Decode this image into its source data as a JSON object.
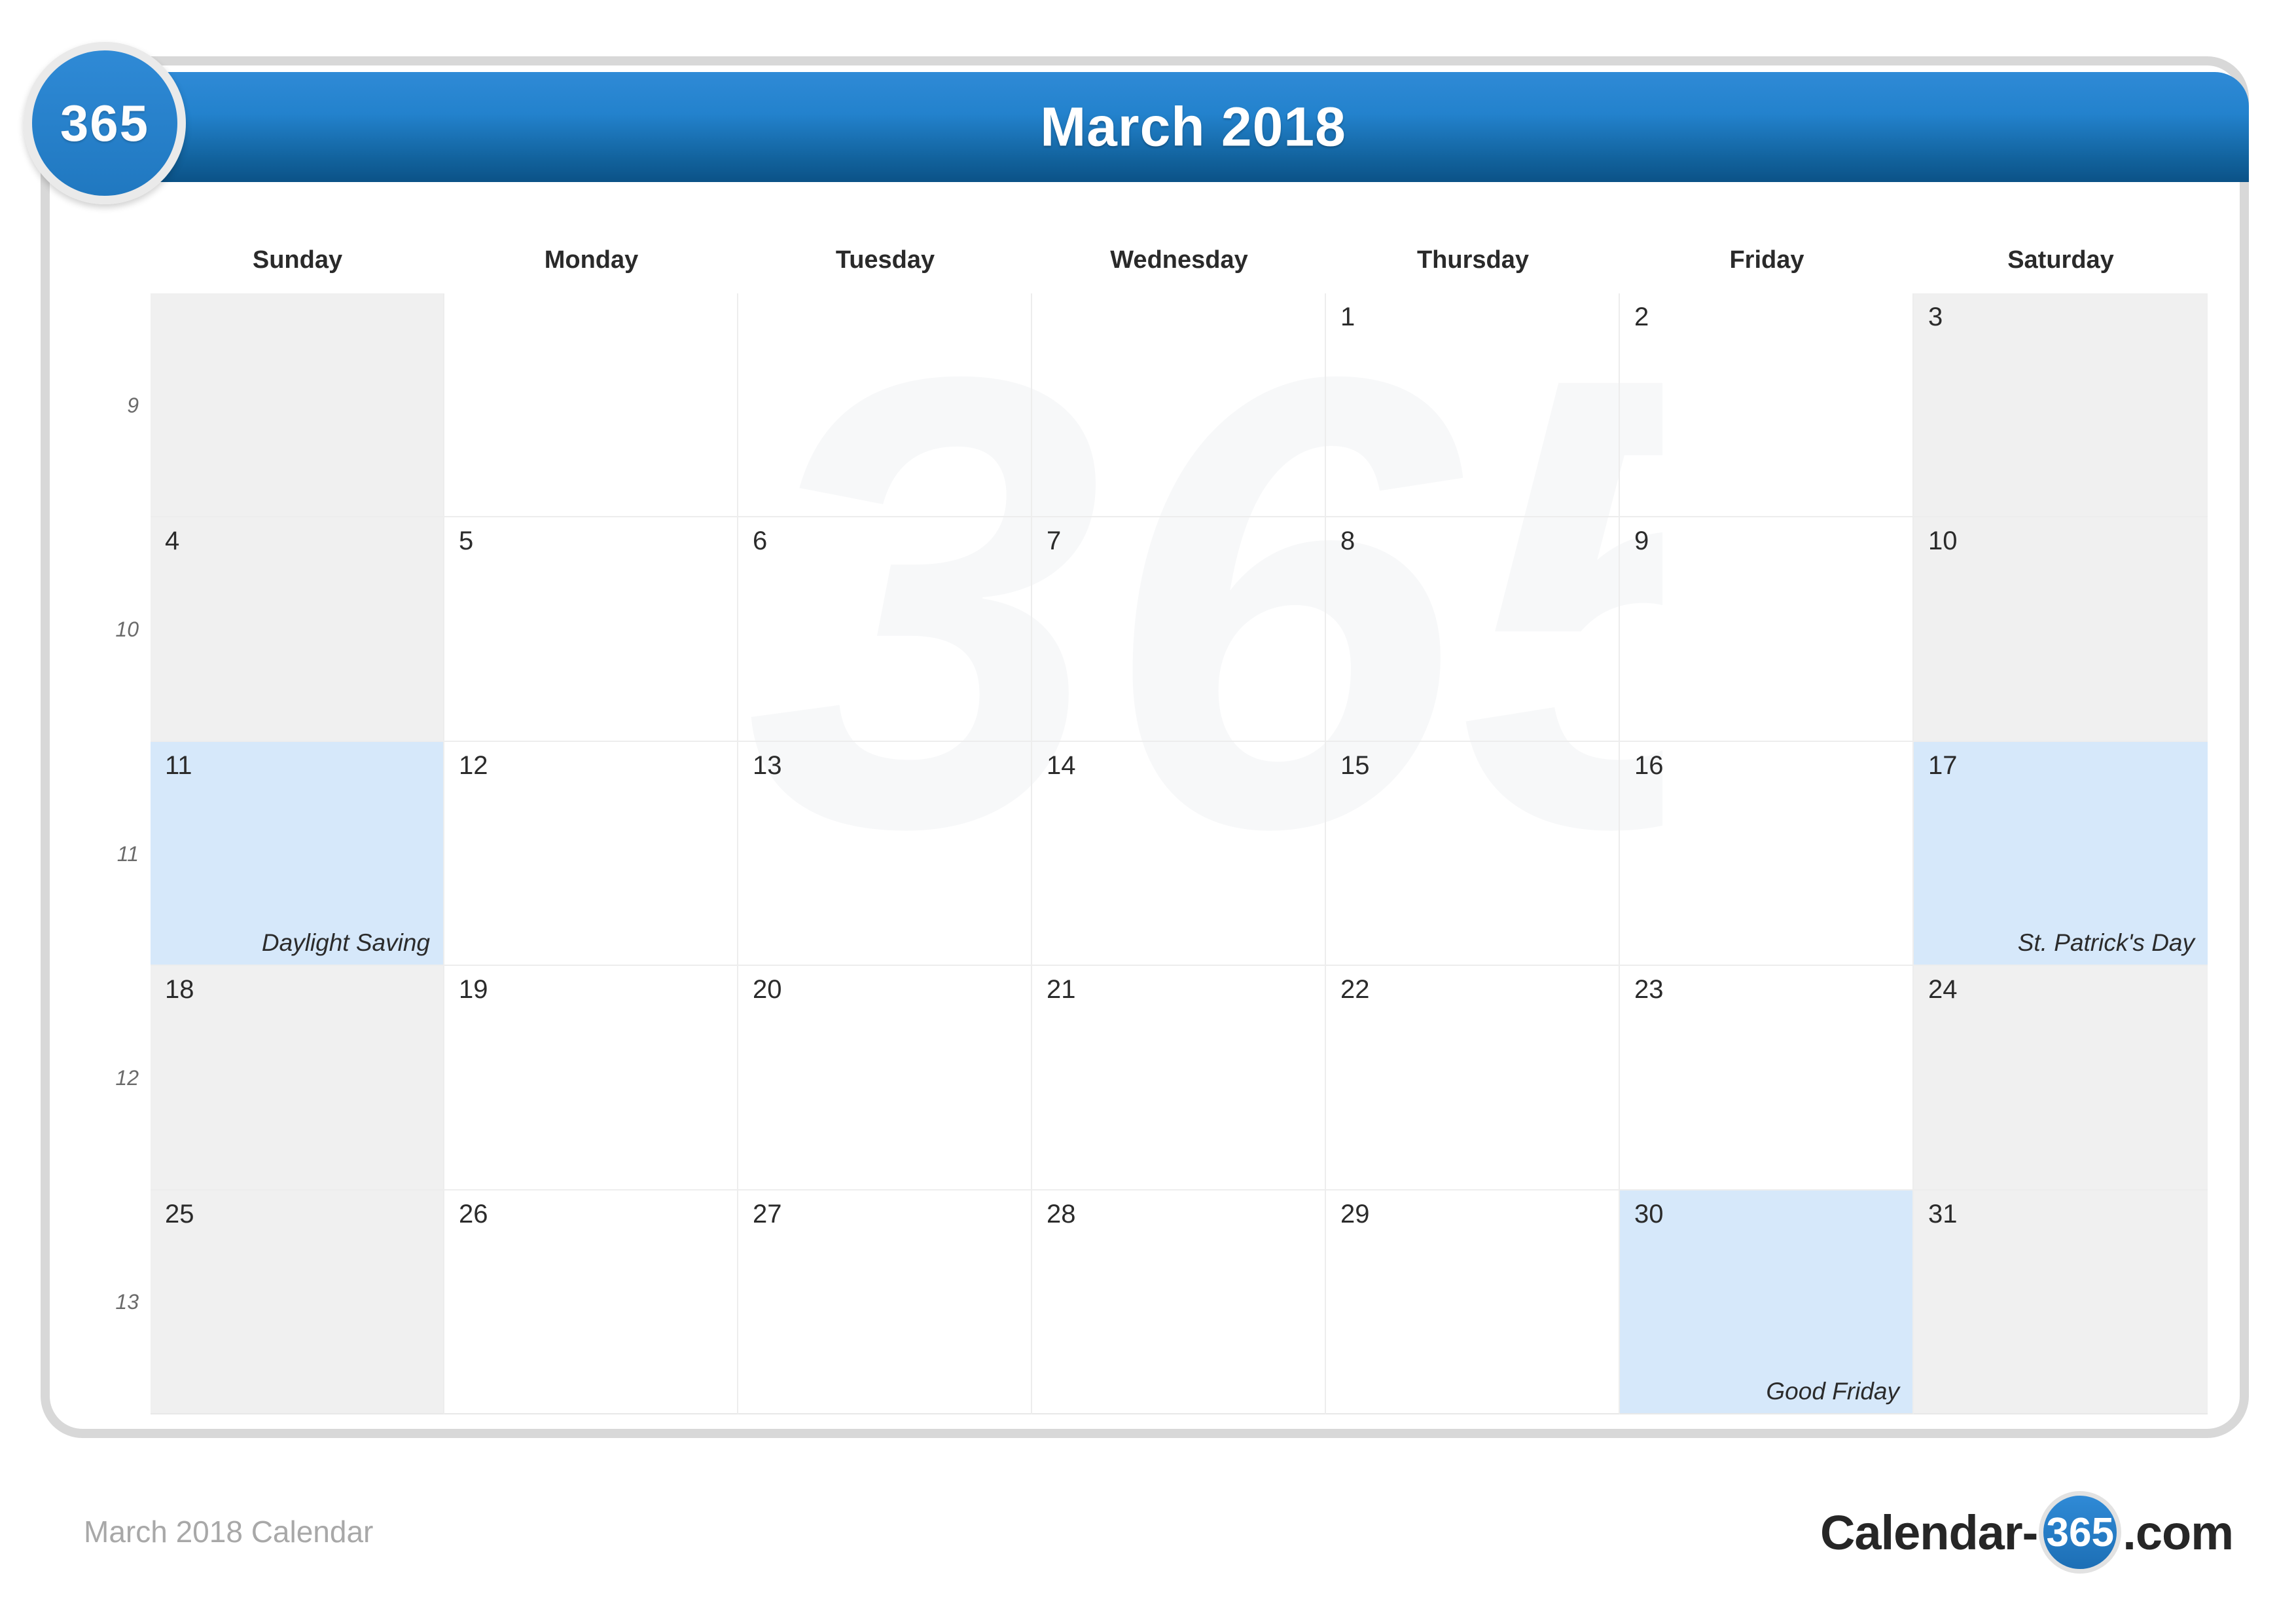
{
  "brand": {
    "badge_label": "365",
    "watermark_text": "365"
  },
  "header": {
    "title": "March 2018"
  },
  "weekdays": [
    "Sunday",
    "Monday",
    "Tuesday",
    "Wednesday",
    "Thursday",
    "Friday",
    "Saturday"
  ],
  "week_numbers": [
    "9",
    "10",
    "11",
    "12",
    "13"
  ],
  "weeks": [
    [
      {
        "date": "",
        "event": "",
        "weekend": true,
        "holiday": false
      },
      {
        "date": "",
        "event": "",
        "weekend": false,
        "holiday": false
      },
      {
        "date": "",
        "event": "",
        "weekend": false,
        "holiday": false
      },
      {
        "date": "",
        "event": "",
        "weekend": false,
        "holiday": false
      },
      {
        "date": "1",
        "event": "",
        "weekend": false,
        "holiday": false
      },
      {
        "date": "2",
        "event": "",
        "weekend": false,
        "holiday": false
      },
      {
        "date": "3",
        "event": "",
        "weekend": true,
        "holiday": false
      }
    ],
    [
      {
        "date": "4",
        "event": "",
        "weekend": true,
        "holiday": false
      },
      {
        "date": "5",
        "event": "",
        "weekend": false,
        "holiday": false
      },
      {
        "date": "6",
        "event": "",
        "weekend": false,
        "holiday": false
      },
      {
        "date": "7",
        "event": "",
        "weekend": false,
        "holiday": false
      },
      {
        "date": "8",
        "event": "",
        "weekend": false,
        "holiday": false
      },
      {
        "date": "9",
        "event": "",
        "weekend": false,
        "holiday": false
      },
      {
        "date": "10",
        "event": "",
        "weekend": true,
        "holiday": false
      }
    ],
    [
      {
        "date": "11",
        "event": "Daylight Saving",
        "weekend": true,
        "holiday": true
      },
      {
        "date": "12",
        "event": "",
        "weekend": false,
        "holiday": false
      },
      {
        "date": "13",
        "event": "",
        "weekend": false,
        "holiday": false
      },
      {
        "date": "14",
        "event": "",
        "weekend": false,
        "holiday": false
      },
      {
        "date": "15",
        "event": "",
        "weekend": false,
        "holiday": false
      },
      {
        "date": "16",
        "event": "",
        "weekend": false,
        "holiday": false
      },
      {
        "date": "17",
        "event": "St. Patrick's Day",
        "weekend": true,
        "holiday": true
      }
    ],
    [
      {
        "date": "18",
        "event": "",
        "weekend": true,
        "holiday": false
      },
      {
        "date": "19",
        "event": "",
        "weekend": false,
        "holiday": false
      },
      {
        "date": "20",
        "event": "",
        "weekend": false,
        "holiday": false
      },
      {
        "date": "21",
        "event": "",
        "weekend": false,
        "holiday": false
      },
      {
        "date": "22",
        "event": "",
        "weekend": false,
        "holiday": false
      },
      {
        "date": "23",
        "event": "",
        "weekend": false,
        "holiday": false
      },
      {
        "date": "24",
        "event": "",
        "weekend": true,
        "holiday": false
      }
    ],
    [
      {
        "date": "25",
        "event": "",
        "weekend": true,
        "holiday": false
      },
      {
        "date": "26",
        "event": "",
        "weekend": false,
        "holiday": false
      },
      {
        "date": "27",
        "event": "",
        "weekend": false,
        "holiday": false
      },
      {
        "date": "28",
        "event": "",
        "weekend": false,
        "holiday": false
      },
      {
        "date": "29",
        "event": "",
        "weekend": false,
        "holiday": false
      },
      {
        "date": "30",
        "event": "Good Friday",
        "weekend": false,
        "holiday": true
      },
      {
        "date": "31",
        "event": "",
        "weekend": true,
        "holiday": false
      }
    ]
  ],
  "footer": {
    "label": "March 2018 Calendar",
    "logo_prefix": "Calendar-",
    "logo_badge": "365",
    "logo_suffix": ".com"
  },
  "colors": {
    "header_blue_light": "#2f8ad6",
    "header_blue_dark": "#0b5287",
    "holiday_blue": "#d6e8fa",
    "weekend_gray": "#f0f0f0",
    "frame_gray": "#d8d8d8",
    "footer_gray": "#a8a8a8"
  }
}
